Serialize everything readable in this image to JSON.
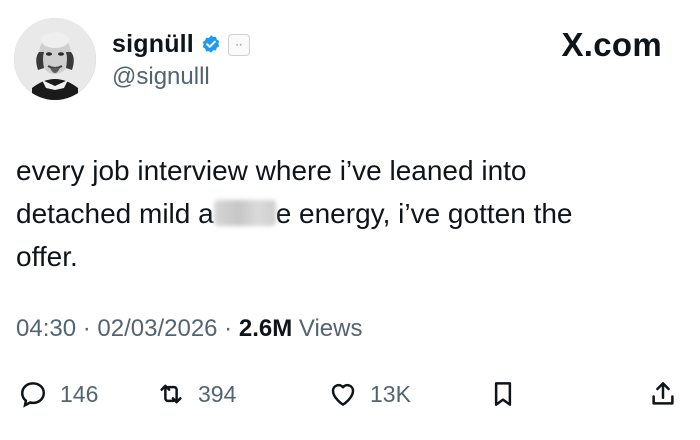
{
  "author": {
    "display_name": "signüll",
    "handle": "@signulll",
    "verified_icon": "verified-badge-icon",
    "emoji_badge": "··"
  },
  "brand": {
    "label": "X.com"
  },
  "tweet": {
    "line1": "every job interview where i’ve leaned into",
    "line2_pre": "detached mild a",
    "line2_post": "e energy, i’ve gotten the",
    "line3": "offer."
  },
  "meta": {
    "time": "04:30",
    "sep1": " · ",
    "date": "02/03/2026",
    "sep2": " · ",
    "views_count": "2.6M",
    "views_label": " Views"
  },
  "actions": {
    "replies": "146",
    "reposts": "394",
    "likes": "13K"
  },
  "colors": {
    "text": "#0f1419",
    "secondary": "#536471",
    "verified": "#1d9bf0"
  }
}
